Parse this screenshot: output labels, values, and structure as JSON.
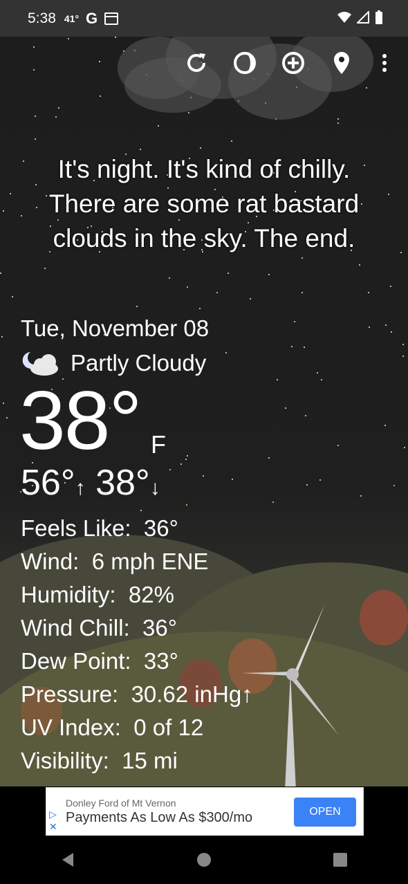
{
  "status_bar": {
    "time": "5:38",
    "temp": "41°",
    "g_label": "G"
  },
  "toolbar": {
    "icons": [
      "refresh-icon",
      "moon-phase-icon",
      "add-location-icon",
      "location-pin-icon",
      "more-menu-icon"
    ]
  },
  "narrative": [
    "It's night. It's kind of chilly.",
    "There are some rat bastard",
    "clouds in the sky. The end."
  ],
  "weather": {
    "date": "Tue, November 08",
    "condition": "Partly Cloudy",
    "temperature": "38°",
    "unit": "F",
    "high": "56°",
    "low": "38°",
    "high_arrow": "↑",
    "low_arrow": "↓"
  },
  "details": [
    {
      "label": "Feels Like:",
      "value": "36°"
    },
    {
      "label": "Wind:",
      "value": "6 mph ENE"
    },
    {
      "label": "Humidity:",
      "value": "82%"
    },
    {
      "label": "Wind Chill:",
      "value": "36°"
    },
    {
      "label": "Dew Point:",
      "value": "33°"
    },
    {
      "label": "Pressure:",
      "value": "30.62 inHg↑"
    },
    {
      "label": "UV Index:",
      "value": "0 of 12"
    },
    {
      "label": "Visibility:",
      "value": "15 mi"
    }
  ],
  "ad": {
    "advertiser": "Donley Ford of Mt Vernon",
    "text": "Payments As Low As $300/mo",
    "button": "OPEN"
  },
  "colors": {
    "sky": "#1f1f1f",
    "ad_button": "#3b82f6",
    "status_bar": "#333333"
  }
}
